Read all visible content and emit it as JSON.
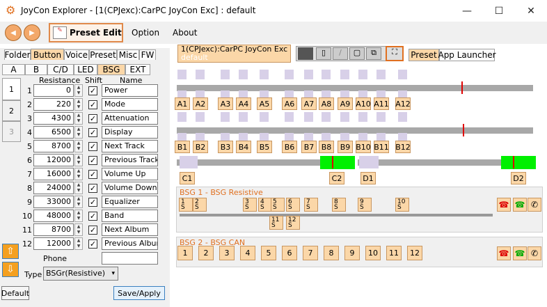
{
  "window": {
    "title": "JoyCon Explorer - [1(CPJexc):CarPC JoyCon Exc] : default"
  },
  "menu": {
    "preset_edit": "Preset Edit",
    "option": "Option",
    "about": "About"
  },
  "main_tabs": [
    "Folder",
    "Button",
    "Voice",
    "Preset",
    "Misc",
    "FW"
  ],
  "sub_tabs": [
    "A",
    "B",
    "C/D",
    "LED",
    "BSG",
    "EXT"
  ],
  "side_tabs": [
    "1",
    "2",
    "3"
  ],
  "table_headers": {
    "resistance": "Resistance",
    "shift": "Shift",
    "name": "Name"
  },
  "rows": [
    {
      "n": "1",
      "res": "0",
      "name": "Power"
    },
    {
      "n": "2",
      "res": "220",
      "name": "Mode"
    },
    {
      "n": "3",
      "res": "4300",
      "name": "Attenuation"
    },
    {
      "n": "4",
      "res": "6500",
      "name": "Display"
    },
    {
      "n": "5",
      "res": "8700",
      "name": "Next Track"
    },
    {
      "n": "6",
      "res": "12000",
      "name": "Previous Track"
    },
    {
      "n": "7",
      "res": "16000",
      "name": "Volume Up"
    },
    {
      "n": "8",
      "res": "24000",
      "name": "Volume Down"
    },
    {
      "n": "9",
      "res": "33000",
      "name": "Equalizer"
    },
    {
      "n": "10",
      "res": "48000",
      "name": "Band"
    },
    {
      "n": "11",
      "res": "8700",
      "name": "Next Album"
    },
    {
      "n": "12",
      "res": "12000",
      "name": "Previous Album"
    }
  ],
  "phone_label": "Phone",
  "type_label": "Type",
  "type_value": "BSGr(Resistive)",
  "buttons": {
    "default": "Default",
    "save": "Save/Apply"
  },
  "doc_tab": {
    "line1": "1(CPJexc):CarPC JoyCon Exc",
    "line2": "default"
  },
  "right_tabs": [
    "Preset",
    "App Launcher"
  ],
  "a_buttons": [
    "A1",
    "A2",
    "A3",
    "A4",
    "A5",
    "A6",
    "A7",
    "A8",
    "A9",
    "A10",
    "A11",
    "A12"
  ],
  "b_buttons": [
    "B1",
    "B2",
    "B3",
    "B4",
    "B5",
    "B6",
    "B7",
    "B8",
    "B9",
    "B10",
    "B11",
    "B12"
  ],
  "cd_buttons": [
    "C1",
    "C2",
    "D1",
    "D2"
  ],
  "bsg1": {
    "title": "BSG 1 - BSG Resistive",
    "flags": [
      {
        "n": "1",
        "s": "S"
      },
      {
        "n": "2",
        "s": "S"
      },
      {
        "n": "3",
        "s": "S"
      },
      {
        "n": "4",
        "s": "S"
      },
      {
        "n": "5",
        "s": "S"
      },
      {
        "n": "6",
        "s": "S"
      },
      {
        "n": "7",
        "s": "S"
      },
      {
        "n": "8",
        "s": "S"
      },
      {
        "n": "9",
        "s": "S"
      },
      {
        "n": "10",
        "s": "S"
      },
      {
        "n": "11",
        "s": "S"
      },
      {
        "n": "12",
        "s": "S"
      }
    ]
  },
  "bsg2": {
    "title": "BSG 2 - BSG CAN",
    "buttons": [
      "1",
      "2",
      "3",
      "4",
      "5",
      "6",
      "7",
      "8",
      "9",
      "10",
      "11",
      "12"
    ]
  },
  "colors": {
    "accent": "#fbd7a8",
    "green": "#00f000",
    "red": "#e00000",
    "bsg_title": "#e07020"
  }
}
